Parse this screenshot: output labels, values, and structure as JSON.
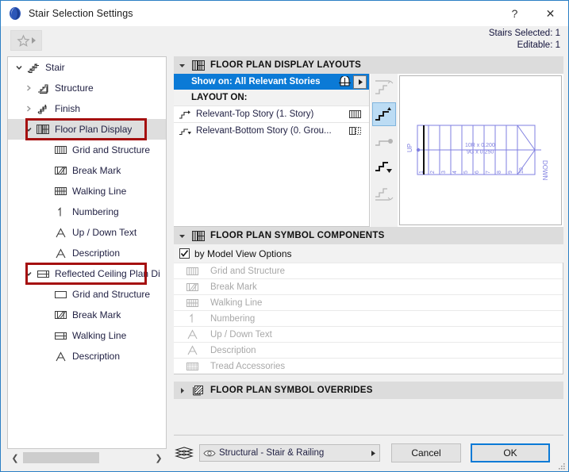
{
  "window": {
    "title": "Stair Selection Settings",
    "app_icon": "archicad-stair-icon",
    "help_button": "?",
    "close_button": "✕"
  },
  "toolbar": {
    "favorites_icon": "star-icon",
    "favorites_arrow_icon": "triangle-right-icon",
    "stairs_selected": "Stairs Selected: 1",
    "editable": "Editable: 1"
  },
  "sidebar": {
    "items": [
      {
        "label": "Stair",
        "icon": "stair-icon",
        "depth": 0,
        "twisty": "down",
        "selected": false
      },
      {
        "label": "Structure",
        "icon": "structure-icon",
        "depth": 1,
        "twisty": "right",
        "selected": false
      },
      {
        "label": "Finish",
        "icon": "finish-icon",
        "depth": 1,
        "twisty": "right",
        "selected": false
      },
      {
        "label": "Floor Plan Display",
        "icon": "floor-plan-display-icon",
        "depth": 1,
        "twisty": "down",
        "selected": true,
        "highlight": true
      },
      {
        "label": "Grid and Structure",
        "icon": "grid-and-structure-icon",
        "depth": 2,
        "twisty": "none",
        "selected": false
      },
      {
        "label": "Break Mark",
        "icon": "break-mark-icon",
        "depth": 2,
        "twisty": "none",
        "selected": false
      },
      {
        "label": "Walking Line",
        "icon": "walking-line-icon",
        "depth": 2,
        "twisty": "none",
        "selected": false
      },
      {
        "label": "Numbering",
        "icon": "numbering-icon",
        "depth": 2,
        "twisty": "none",
        "selected": false
      },
      {
        "label": "Up / Down Text",
        "icon": "text-a-icon",
        "depth": 2,
        "twisty": "none",
        "selected": false
      },
      {
        "label": "Description",
        "icon": "text-a-icon",
        "depth": 2,
        "twisty": "none",
        "selected": false
      },
      {
        "label": "Reflected Ceiling Plan Di",
        "icon": "reflected-ceiling-icon",
        "depth": 1,
        "twisty": "down",
        "selected": false,
        "highlight": true
      },
      {
        "label": "Grid and Structure",
        "icon": "rcp-grid-icon",
        "depth": 2,
        "twisty": "none",
        "selected": false
      },
      {
        "label": "Break Mark",
        "icon": "break-mark-icon",
        "depth": 2,
        "twisty": "none",
        "selected": false
      },
      {
        "label": "Walking Line",
        "icon": "rcp-walking-line-icon",
        "depth": 2,
        "twisty": "none",
        "selected": false
      },
      {
        "label": "Description",
        "icon": "text-a-icon",
        "depth": 2,
        "twisty": "none",
        "selected": false
      }
    ],
    "scroll_left_icon": "chevron-left-icon",
    "scroll_right_icon": "chevron-right-icon"
  },
  "layouts_section": {
    "header": "FLOOR PLAN DISPLAY LAYOUTS",
    "header_icon": "floor-plan-display-icon",
    "twisty": "down",
    "show_on": {
      "label": "Show on: All Relevant Stories",
      "icon": "stories-icon",
      "more_icon": "triangle-right-icon"
    },
    "layout_on_label": "LAYOUT ON:",
    "rows": [
      {
        "label": "Relevant-Top Story (1. Story)",
        "icon": "top-story-icon",
        "right_icon": "grid-solid-icon"
      },
      {
        "label": "Relevant-Bottom Story (0. Grou...",
        "icon": "bottom-story-icon",
        "right_icon": "grid-dashed-icon"
      }
    ],
    "preview_tools": [
      {
        "icon": "stair-layout-top-icon",
        "selected": false
      },
      {
        "icon": "stair-layout-relevant-top-icon",
        "selected": true
      },
      {
        "icon": "stair-layout-middle-icon",
        "selected": false
      },
      {
        "icon": "stair-layout-bottom-icon",
        "selected": false
      },
      {
        "icon": "stair-layout-below-icon",
        "selected": false
      }
    ],
    "preview": {
      "up_label": "UP",
      "down_label": "DOWN",
      "riser_text": "10R x 0.200",
      "going_text": "9G x 0.250",
      "tread_numbers": [
        "1",
        "2",
        "3",
        "4",
        "5",
        "6",
        "7",
        "8",
        "9",
        "10"
      ],
      "line_color": "#7f7fe0"
    }
  },
  "components_section": {
    "header": "FLOOR PLAN SYMBOL COMPONENTS",
    "header_icon": "floor-plan-display-icon",
    "twisty": "down",
    "mvo_label": "by Model View Options",
    "mvo_checked": true,
    "rows": [
      {
        "label": "Grid and Structure",
        "icon": "grid-and-structure-icon"
      },
      {
        "label": "Break Mark",
        "icon": "break-mark-icon"
      },
      {
        "label": "Walking Line",
        "icon": "walking-line-icon"
      },
      {
        "label": "Numbering",
        "icon": "numbering-icon"
      },
      {
        "label": "Up / Down Text",
        "icon": "text-a-icon"
      },
      {
        "label": "Description",
        "icon": "text-a-icon"
      },
      {
        "label": "Tread Accessories",
        "icon": "tread-accessories-icon"
      }
    ]
  },
  "overrides_section": {
    "header": "FLOOR PLAN SYMBOL OVERRIDES",
    "header_icon": "override-hatch-icon",
    "twisty": "right"
  },
  "footer": {
    "layer_icon": "layers-icon",
    "layer_eye_icon": "eye-icon",
    "layer_name": "Structural - Stair & Railing",
    "layer_arrow_icon": "triangle-right-icon",
    "cancel_label": "Cancel",
    "ok_label": "OK"
  },
  "colors": {
    "accent": "#0b7ad6",
    "highlight_box": "#a51010",
    "selection_row": "#0b7ad6",
    "tree_selected": "#dedede",
    "text": "#222244",
    "disabled_text": "#a8a8a8",
    "preview_line": "#7f7fe0"
  }
}
